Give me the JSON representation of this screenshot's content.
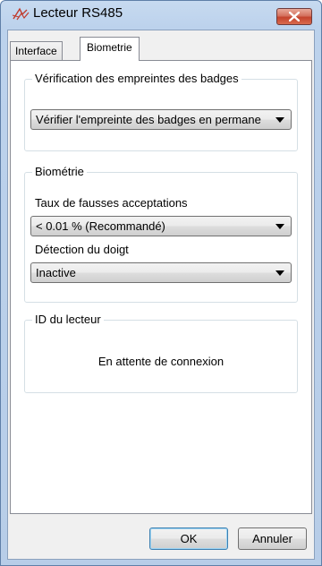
{
  "window": {
    "title": "Lecteur RS485",
    "close_label": "Close"
  },
  "tabs": [
    {
      "label": "Interface",
      "active": false
    },
    {
      "label": "Biometrie",
      "active": true
    }
  ],
  "verification": {
    "title": "Vérification des empreintes des badges",
    "selected": "Vérifier l'empreinte des badges en permane"
  },
  "biometrie": {
    "title": "Biométrie",
    "far_label": "Taux de fausses acceptations",
    "far_selected": "< 0.01 % (Recommandé)",
    "finger_label": "Détection du doigt",
    "finger_selected": "Inactive"
  },
  "reader_id": {
    "title": "ID du lecteur",
    "status": "En attente de connexion"
  },
  "buttons": {
    "ok": "OK",
    "cancel": "Annuler"
  }
}
